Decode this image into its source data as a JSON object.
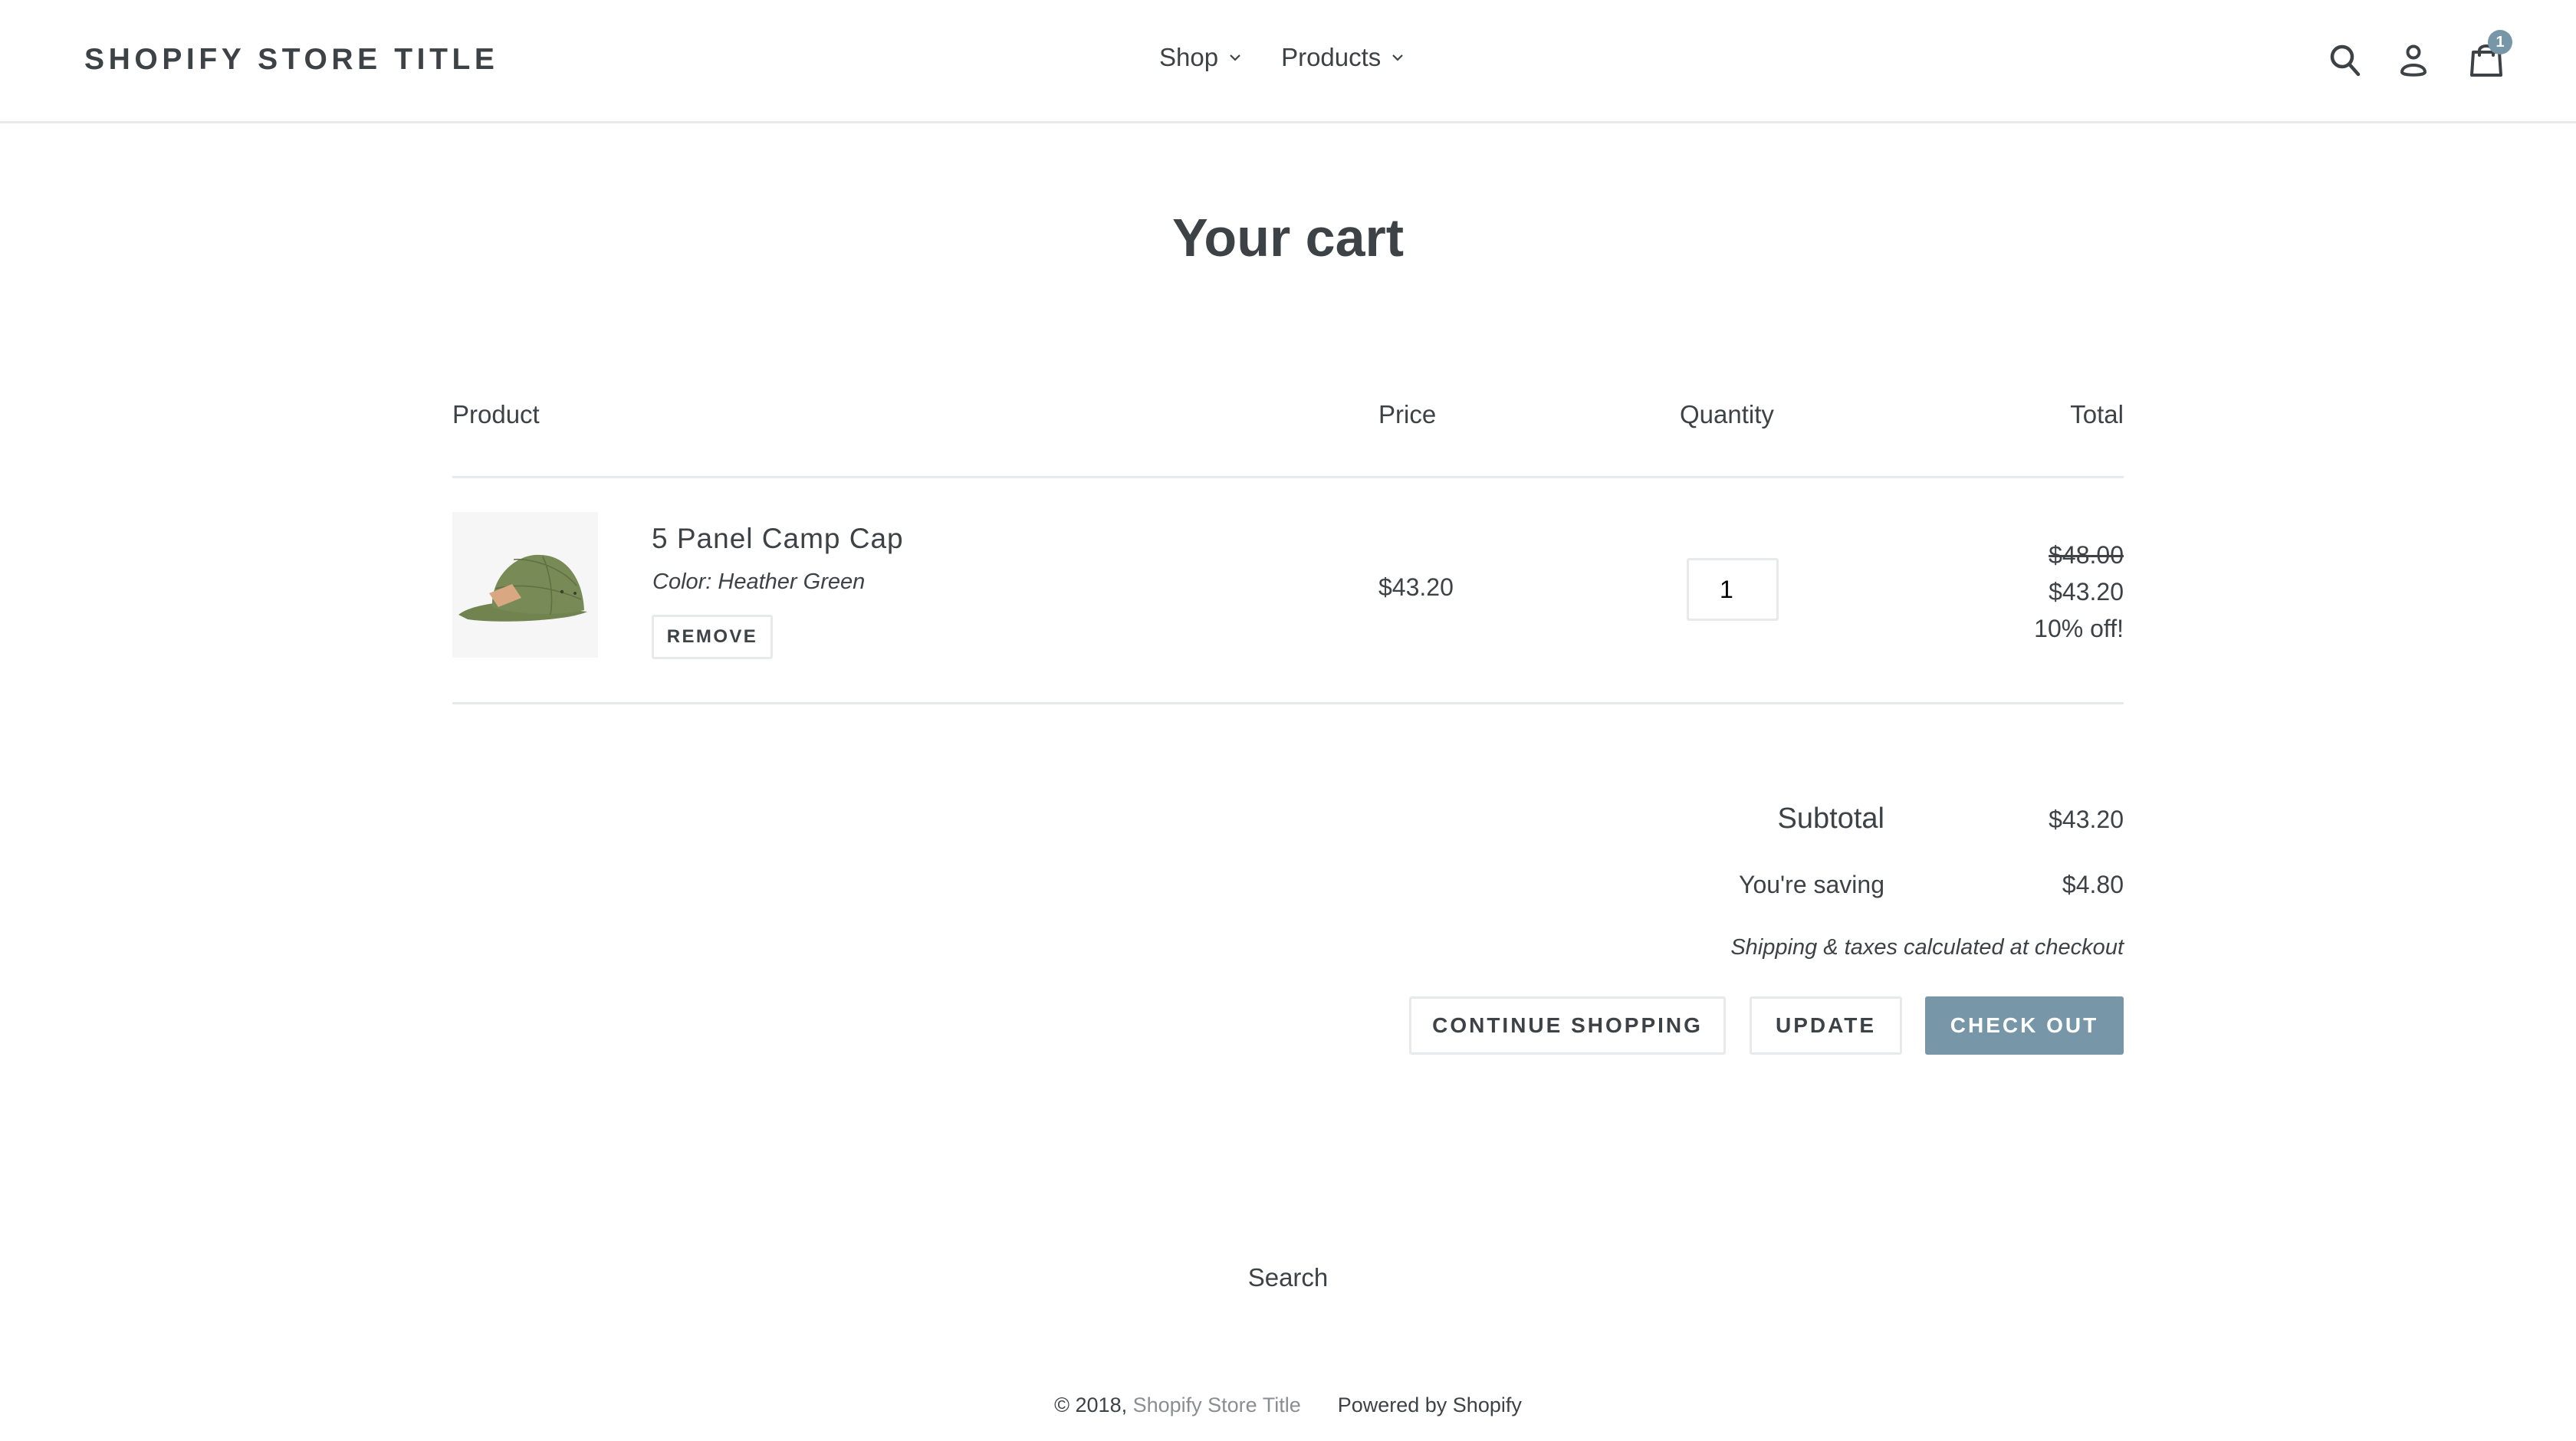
{
  "header": {
    "logo": "SHOPIFY STORE TITLE",
    "nav": [
      {
        "label": "Shop",
        "icon": "chevron-down-icon"
      },
      {
        "label": "Products",
        "icon": "chevron-down-icon"
      }
    ],
    "icons": {
      "search": "search-icon",
      "account": "account-icon",
      "cart": "cart-bag-icon"
    },
    "cart_count": "1",
    "badge_color": "#7796a8"
  },
  "page": {
    "title": "Your cart"
  },
  "table": {
    "headers": {
      "product": "Product",
      "price": "Price",
      "quantity": "Quantity",
      "total": "Total"
    },
    "items": [
      {
        "title": "5 Panel Camp Cap",
        "variant": "Color: Heather Green",
        "remove_label": "REMOVE",
        "price": "$43.20",
        "quantity": "1",
        "original_total": "$48.00",
        "total": "$43.20",
        "discount": "10% off!"
      }
    ]
  },
  "summary": {
    "subtotal_label": "Subtotal",
    "subtotal_value": "$43.20",
    "saving_label": "You're saving",
    "saving_value": "$4.80",
    "shipping_note": "Shipping & taxes calculated at checkout"
  },
  "buttons": {
    "continue": "CONTINUE SHOPPING",
    "update": "UPDATE",
    "checkout": "CHECK OUT",
    "checkout_color": "#7796a8"
  },
  "footer": {
    "search_link": "Search",
    "copyright_prefix": "© 2018, ",
    "store_link": "Shopify Store Title",
    "powered_by": "Powered by Shopify"
  }
}
